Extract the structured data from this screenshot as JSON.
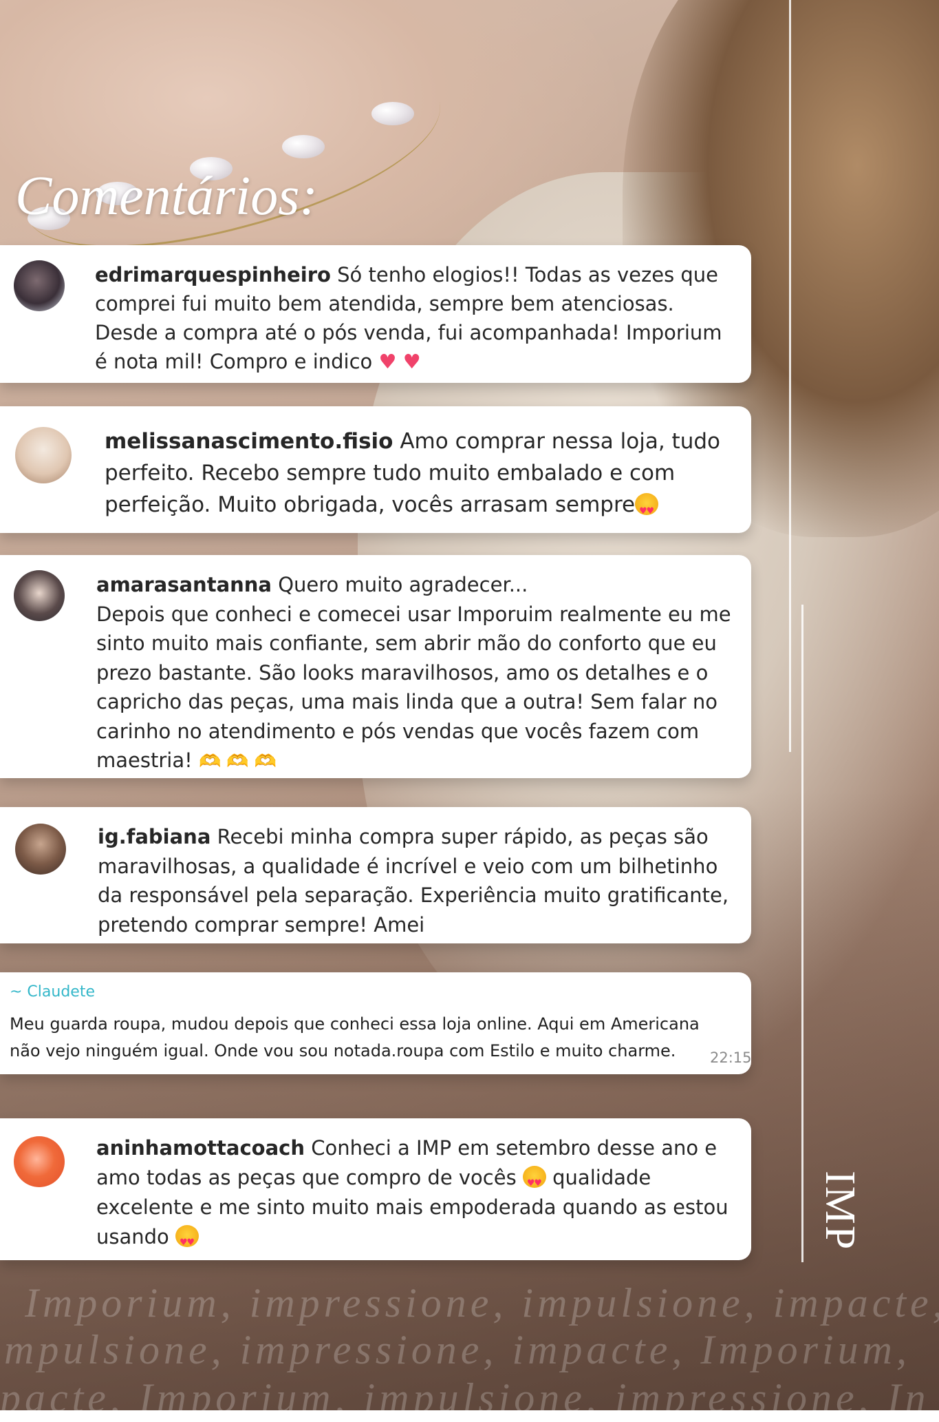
{
  "title": "Comentários:",
  "brand": "IMP",
  "comments": [
    {
      "user": "edrimarquespinheiro",
      "text": " Só tenho elogios!! Todas as vezes que comprei fui muito bem atendida, sempre bem atenciosas. Desde a compra até o pós venda, fui acompanhada! Imporium é nota mil! Compro e indico "
    },
    {
      "user": "melissanascimento.fisio",
      "text": " Amo comprar nessa loja, tudo perfeito. Recebo sempre tudo muito embalado e com perfeição. Muito obrigada, vocês arrasam sempre"
    },
    {
      "user": "amarasantanna",
      "text": " Quero muito agradecer...",
      "text2": "Depois que conheci e comecei usar Imporuim realmente eu me sinto muito mais confiante, sem abrir mão do conforto que eu prezo bastante. São looks maravilhosos, amo os detalhes e o capricho das peças, uma mais linda que a outra! Sem falar no carinho no atendimento e pós vendas que vocês fazem com maestria! "
    },
    {
      "user": "ig.fabiana",
      "text": " Recebi minha compra super rápido, as peças são maravilhosas, a qualidade é incrível e veio com um bilhetinho da responsável pela separação. Experiência muito gratificante, pretendo comprar sempre! Amei"
    },
    {
      "user": "~ Claudete",
      "text": "Meu guarda roupa, mudou depois que conheci essa loja online. Aqui em Americana não vejo ninguém igual. Onde vou sou notada.roupa com Estilo e muito charme.",
      "time": "22:15"
    },
    {
      "user": "aninhamottacoach",
      "text": " Conheci a IMP em setembro desse ano e amo todas as peças que compro de vocês ",
      "text2": " qualidade excelente e me sinto muito mais empoderada quando as estou usando "
    }
  ],
  "watermark": [
    "Imporium, impressione, impulsione, impacte,",
    "mpulsione, impressione, impacte, Imporium,",
    "pacte, Imporium, impulsione, impressione, In"
  ],
  "emoji": {
    "heart": "♥",
    "hands": "🫶🫶🫶"
  }
}
